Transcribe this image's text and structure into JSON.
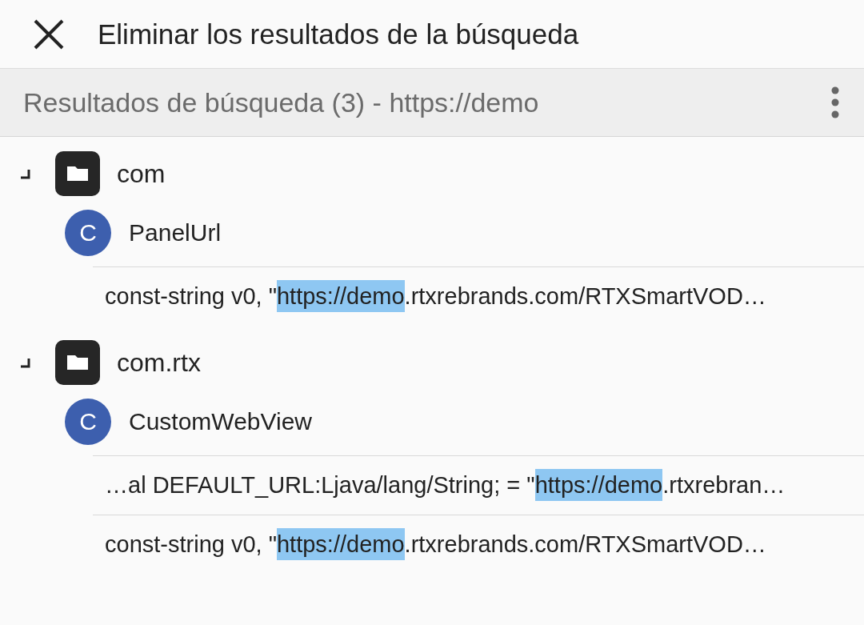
{
  "header": {
    "title": "Eliminar los resultados de la búsqueda"
  },
  "results_bar": {
    "title": "Resultados de búsqueda (3) - https://demo"
  },
  "tree": [
    {
      "name": "com",
      "expanded": true,
      "children": [
        {
          "badge": "C",
          "name": "PanelUrl",
          "matches": [
            {
              "before": "const-string v0, \"",
              "match": "https://demo",
              "after": ".rtxrebrands.com/RTXSmartVOD…"
            }
          ]
        }
      ]
    },
    {
      "name": "com.rtx",
      "expanded": true,
      "children": [
        {
          "badge": "C",
          "name": "CustomWebView",
          "matches": [
            {
              "before": "…al DEFAULT_URL:Ljava/lang/String; = \"",
              "match": "https://demo",
              "after": ".rtxrebran…"
            },
            {
              "before": "const-string v0, \"",
              "match": "https://demo",
              "after": ".rtxrebrands.com/RTXSmartVOD…"
            }
          ]
        }
      ]
    }
  ]
}
